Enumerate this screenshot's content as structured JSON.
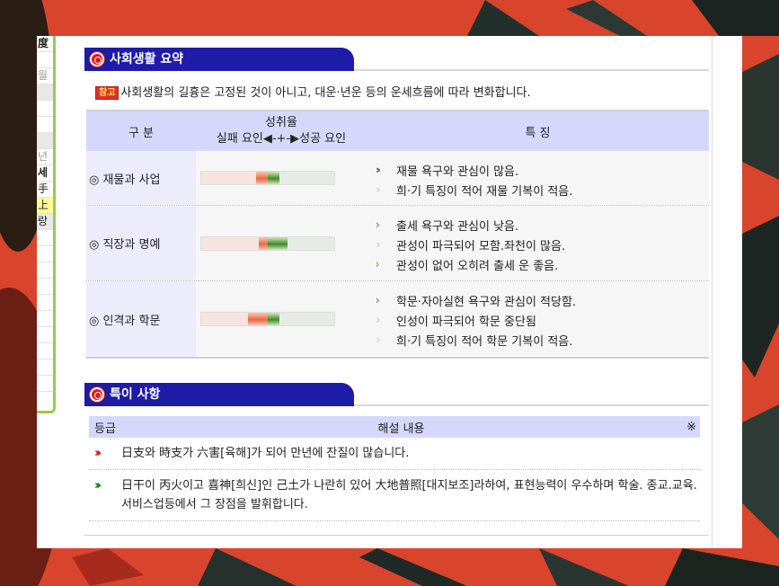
{
  "colors": {
    "tab_bg": "#1e1ba8",
    "header_bg": "#d6d8fb",
    "category_bg": "#ececfb",
    "badge_bg": "#e0302c",
    "fail": "#e86a4b",
    "success": "#3d8a2a"
  },
  "left_panel": {
    "rows": [
      "度",
      "",
      "월",
      "",
      "",
      "",
      "",
      "년",
      "세",
      "手",
      "上",
      "랑",
      "",
      "",
      "",
      "",
      "",
      "",
      "",
      "",
      "",
      ""
    ]
  },
  "social": {
    "title": "사회생활 요약",
    "note_badge": "참고",
    "note": "사회생활의 길흉은 고정된 것이 아니고, 대운·년운 등의 운세흐름에 따라 변화합니다.",
    "headers": {
      "category": "구 분",
      "rate_title": "성취율",
      "rate_scale": "실패 요인◀-+-▶성공 요인",
      "features": "특 징"
    },
    "rows": [
      {
        "category": "◎ 재물과 사업",
        "fail": 0.17,
        "success": 0.17,
        "features": [
          {
            "text": "재물 욕구와 관심이 많음.",
            "icon": "double-chevron-dark"
          },
          {
            "text": "희·기 특징이 적어 재물 기복이 적음.",
            "icon": "double-chevron-light"
          }
        ]
      },
      {
        "category": "◎ 직장과 명예",
        "fail": 0.13,
        "success": 0.3,
        "features": [
          {
            "text": "출세 욕구와 관심이 낮음.",
            "icon": "chevron-dark"
          },
          {
            "text": "관성이 파극되어 모함.좌천이 많음.",
            "icon": "double-chevron-light"
          },
          {
            "text": "관성이 없어 오히려 출세 운 좋음.",
            "icon": "chevron-green"
          }
        ]
      },
      {
        "category": "◎ 인격과 학문",
        "fail": 0.3,
        "success": 0.17,
        "features": [
          {
            "text": "학문·자아실현 욕구와 관심이 적당함.",
            "icon": "chevron-dark"
          },
          {
            "text": "인성이 파극되어 학문 중단됨",
            "icon": "double-chevron-light"
          },
          {
            "text": "희·기 특징이 적어 학문 기복이 적음.",
            "icon": "double-chevron-light"
          }
        ]
      }
    ]
  },
  "special": {
    "title": "특이 사항",
    "headers": {
      "grade": "등급",
      "content": "해설 내용",
      "mark": "※"
    },
    "rows": [
      {
        "grade_icon": "triple-chevron-red",
        "text": "日支와 時支가 六害[육해]가 되어 만년에 잔질이 많습니다."
      },
      {
        "grade_icon": "triple-chevron-green",
        "text": "日干이 丙火이고 喜神[희신]인 己土가 나란히 있어 大地普照[대지보조]라하여, 표현능력이 우수하며 학술. 종교.교육.서비스업등에서 그 장점을 발휘합니다."
      }
    ]
  }
}
